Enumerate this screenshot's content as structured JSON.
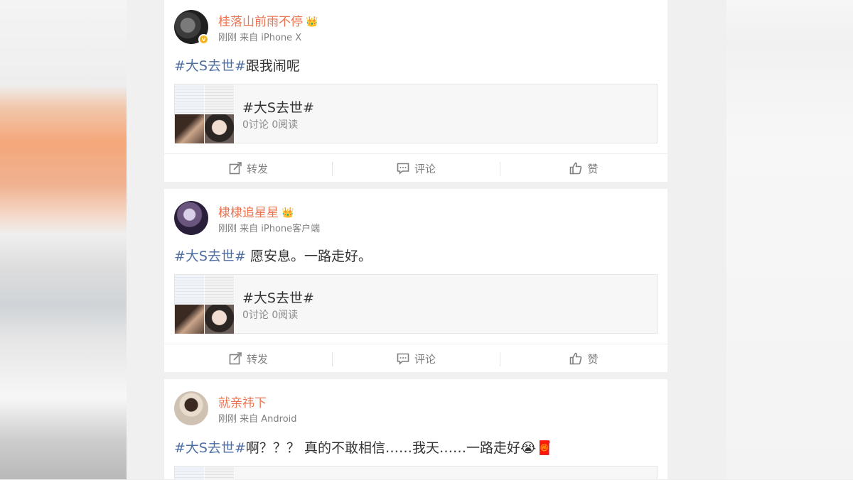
{
  "posts": [
    {
      "username": "桂落山前雨不停",
      "crown": "👑",
      "verified_mark": "v",
      "meta": "刚刚 来自 iPhone X",
      "hashtag": "#大S去世#",
      "text": "跟我闹呢",
      "topic": {
        "title": "#大S去世#",
        "stats": "0讨论 0阅读"
      },
      "actions": {
        "repost": "转发",
        "comment": "评论",
        "like": "赞"
      }
    },
    {
      "username": "棣棣追星星",
      "crown": "👑",
      "meta": "刚刚 来自 iPhone客户端",
      "hashtag": "#大S去世#",
      "text": " 愿安息。一路走好。",
      "topic": {
        "title": "#大S去世#",
        "stats": "0讨论 0阅读"
      },
      "actions": {
        "repost": "转发",
        "comment": "评论",
        "like": "赞"
      }
    },
    {
      "username": "就亲祎下",
      "meta": "刚刚 来自 Android",
      "hashtag": "#大S去世#",
      "text": "啊？？？ 真的不敢相信……我天……一路走好😭🧧"
    }
  ],
  "colors": {
    "username": "#eb7350",
    "hashtag": "#4d6ea3",
    "meta": "#808080",
    "text": "#333333"
  }
}
